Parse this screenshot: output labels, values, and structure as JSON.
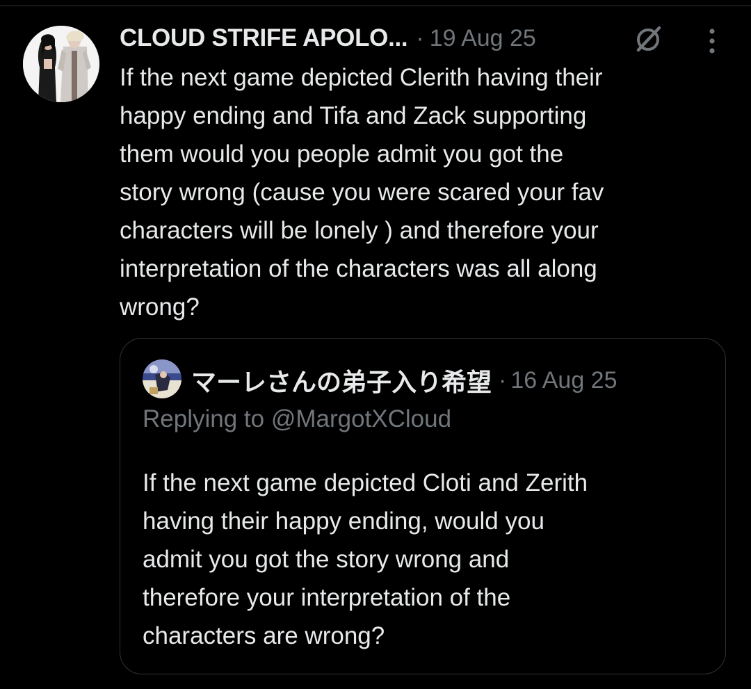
{
  "tweet": {
    "display_name": "CLOUD STRIFE APOLO...",
    "separator": "·",
    "timestamp": "19 Aug 25",
    "text": "If the next game depicted Clerith having their\nhappy ending and Tifa and Zack supporting\nthem would you people admit you got the\nstory wrong (cause you were scared your fav\ncharacters will be lonely ) and therefore your\ninterpretation of the characters was all along\nwrong?",
    "icons": {
      "grok": "grok-icon",
      "more": "more-vertical-icon",
      "avatar": "avatar"
    }
  },
  "quoted_tweet": {
    "display_name": "マーレさんの弟子入り希望",
    "separator": "·",
    "timestamp": "16 Aug 25",
    "replying_to": "Replying to @MargotXCloud",
    "text": "If the next game depicted Cloti and Zerith\nhaving their happy ending, would you\nadmit you got the story wrong and\ntherefore your interpretation of the\ncharacters are wrong?"
  },
  "colors": {
    "background": "#000000",
    "primary_text": "#e7e9ea",
    "secondary_text": "#71767b",
    "border": "#2f3336"
  }
}
